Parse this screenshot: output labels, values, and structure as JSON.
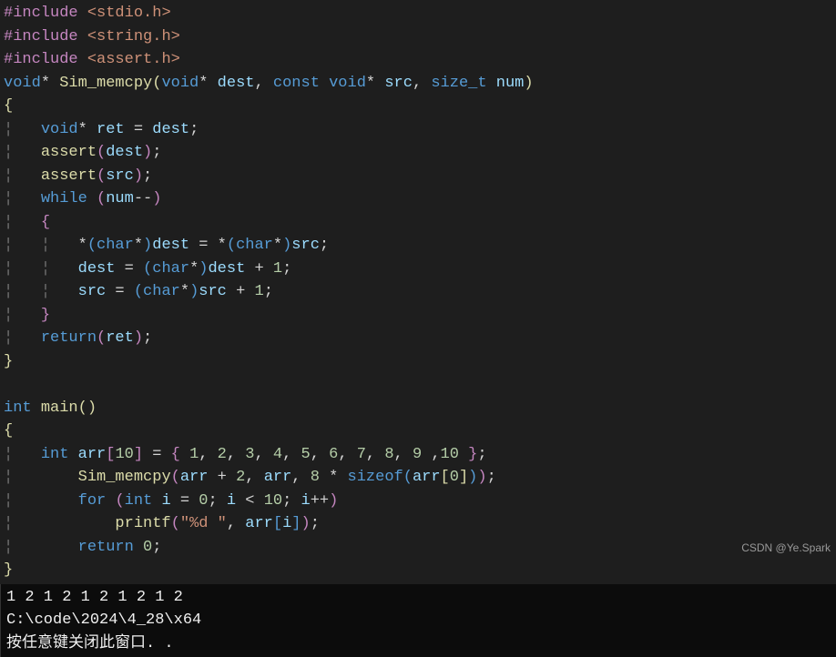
{
  "code": {
    "line1_preproc": "#include ",
    "line1_header": "<stdio.h>",
    "line2_preproc": "#include ",
    "line2_header": "<string.h>",
    "line3_preproc": "#include ",
    "line3_header": "<assert.h>",
    "fn_void": "void",
    "fn_star": "*",
    "fn_name": "Sim_memcpy",
    "fn_dest": "dest",
    "fn_const": "const",
    "fn_src": "src",
    "fn_sizet": "size_t",
    "fn_num": "num",
    "brace_open": "{",
    "brace_close": "}",
    "ret_var": "ret",
    "eq": " = ",
    "semi": ";",
    "assert_fn": "assert",
    "while_kw": "while",
    "num_var": "num",
    "dec": "--",
    "char_kw": "char",
    "one": "1",
    "return_kw": "return",
    "int_kw": "int",
    "main_fn": "main",
    "arr_var": "arr",
    "ten": "10",
    "arr_init": "{ 1, 2, 3, 4, 5, 6, 7, 8, 9 ,10 }",
    "n1": "1",
    "n2": "2",
    "n3": "3",
    "n4": "4",
    "n5": "5",
    "n6": "6",
    "n7": "7",
    "n8": "8",
    "n9": "9",
    "n10": "10",
    "two": "2",
    "eight": "8",
    "sizeof_kw": "sizeof",
    "zero": "0",
    "for_kw": "for",
    "i_var": "i",
    "lt": "<",
    "inc": "++",
    "printf_fn": "printf",
    "fmt_str": "\"%d \"",
    "guide": "¦"
  },
  "terminal": {
    "output": "1 2 1 2 1 2 1 2 1 2",
    "path": "C:\\code\\2024\\4_28\\x64",
    "prompt": "按任意键关闭此窗口. ."
  },
  "watermark": "CSDN @Ye.Spark"
}
